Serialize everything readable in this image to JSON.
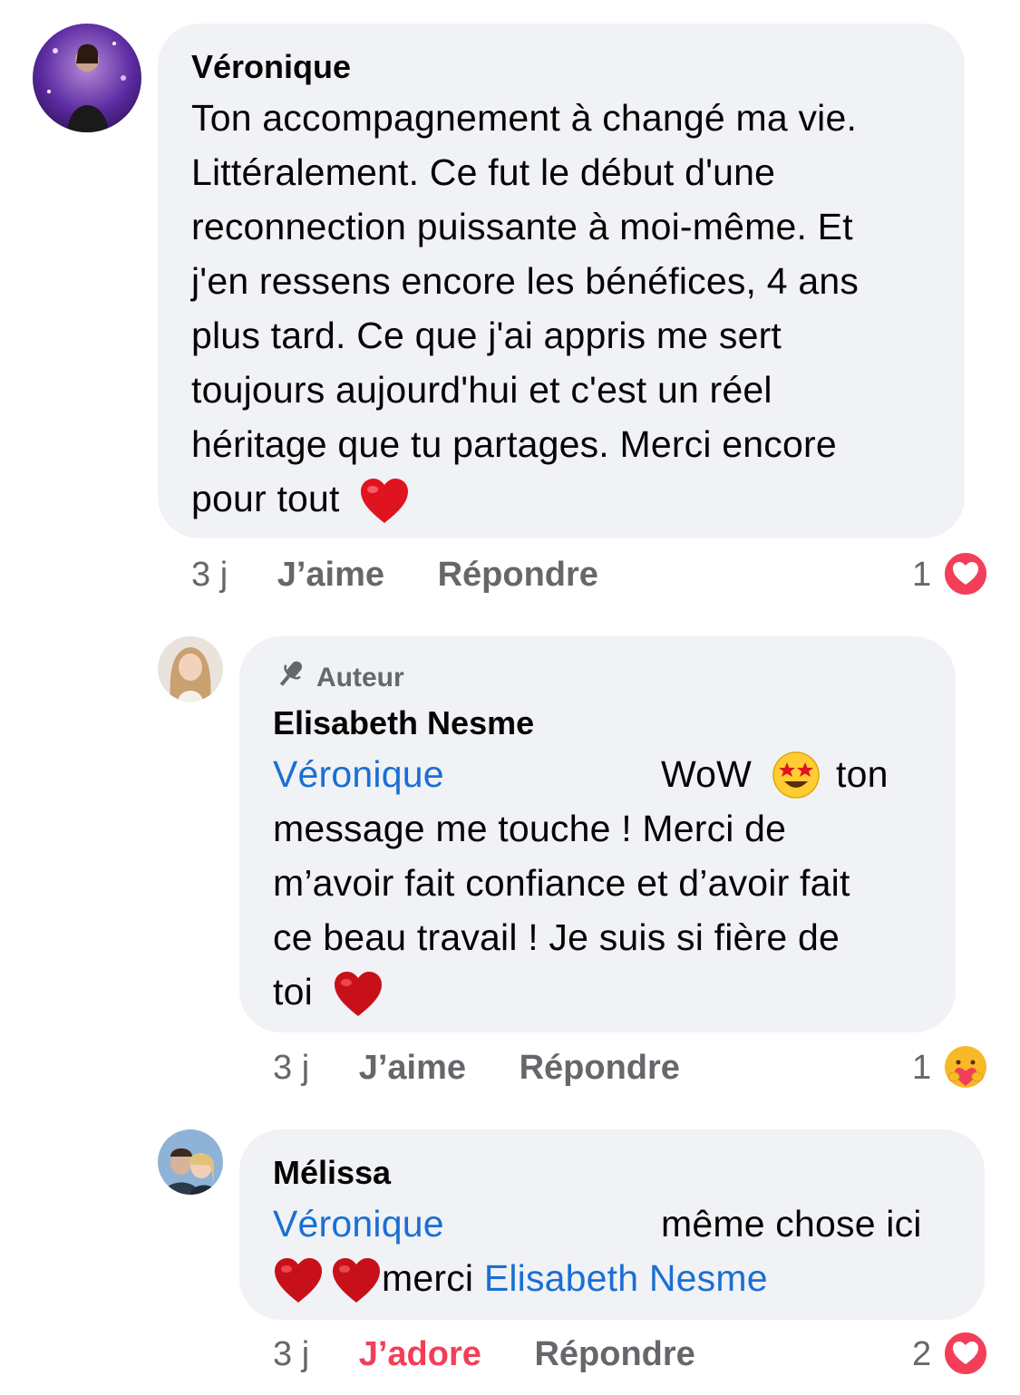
{
  "comments": [
    {
      "author": "Véronique",
      "lines": [
        "Ton accompagnement à changé ma vie.",
        "Littéralement. Ce fut le début d'une",
        "reconnection puissante à moi-même. Et",
        "j'en ressens encore les bénéfices, 4 ans",
        "plus tard. Ce que j'ai appris me sert",
        "toujours aujourd'hui et c'est un réel",
        "héritage que tu partages. Merci encore",
        "pour tout"
      ],
      "time": "3 j",
      "like_label": "J’aime",
      "reply_label": "Répondre",
      "reaction_count": "1",
      "reaction_icon": "love-reaction-icon"
    },
    {
      "badge": "Auteur",
      "author": "Elisabeth Nesme",
      "mention": "Véronique",
      "first_line_text": "WoW",
      "first_line_end": "ton",
      "lines": [
        "message me touche ! Merci de",
        "m’avoir fait confiance et d’avoir fait",
        "ce beau travail ! Je suis si fière de",
        "toi"
      ],
      "time": "3 j",
      "like_label": "J’aime",
      "reply_label": "Répondre",
      "reaction_count": "1",
      "reaction_icon": "care-reaction-icon"
    },
    {
      "author": "Mélissa",
      "mention": "Véronique",
      "first_line_text": "même chose ici",
      "second_line_text": "merci",
      "second_line_mention": "Elisabeth Nesme",
      "time": "3 j",
      "like_label": "J’adore",
      "reply_label": "Répondre",
      "reaction_count": "2",
      "reaction_icon": "love-reaction-icon"
    }
  ],
  "colors": {
    "bubble": "#f0f2f5",
    "mention": "#1a6fd3",
    "meta": "#65676b",
    "love": "#f33e58"
  }
}
